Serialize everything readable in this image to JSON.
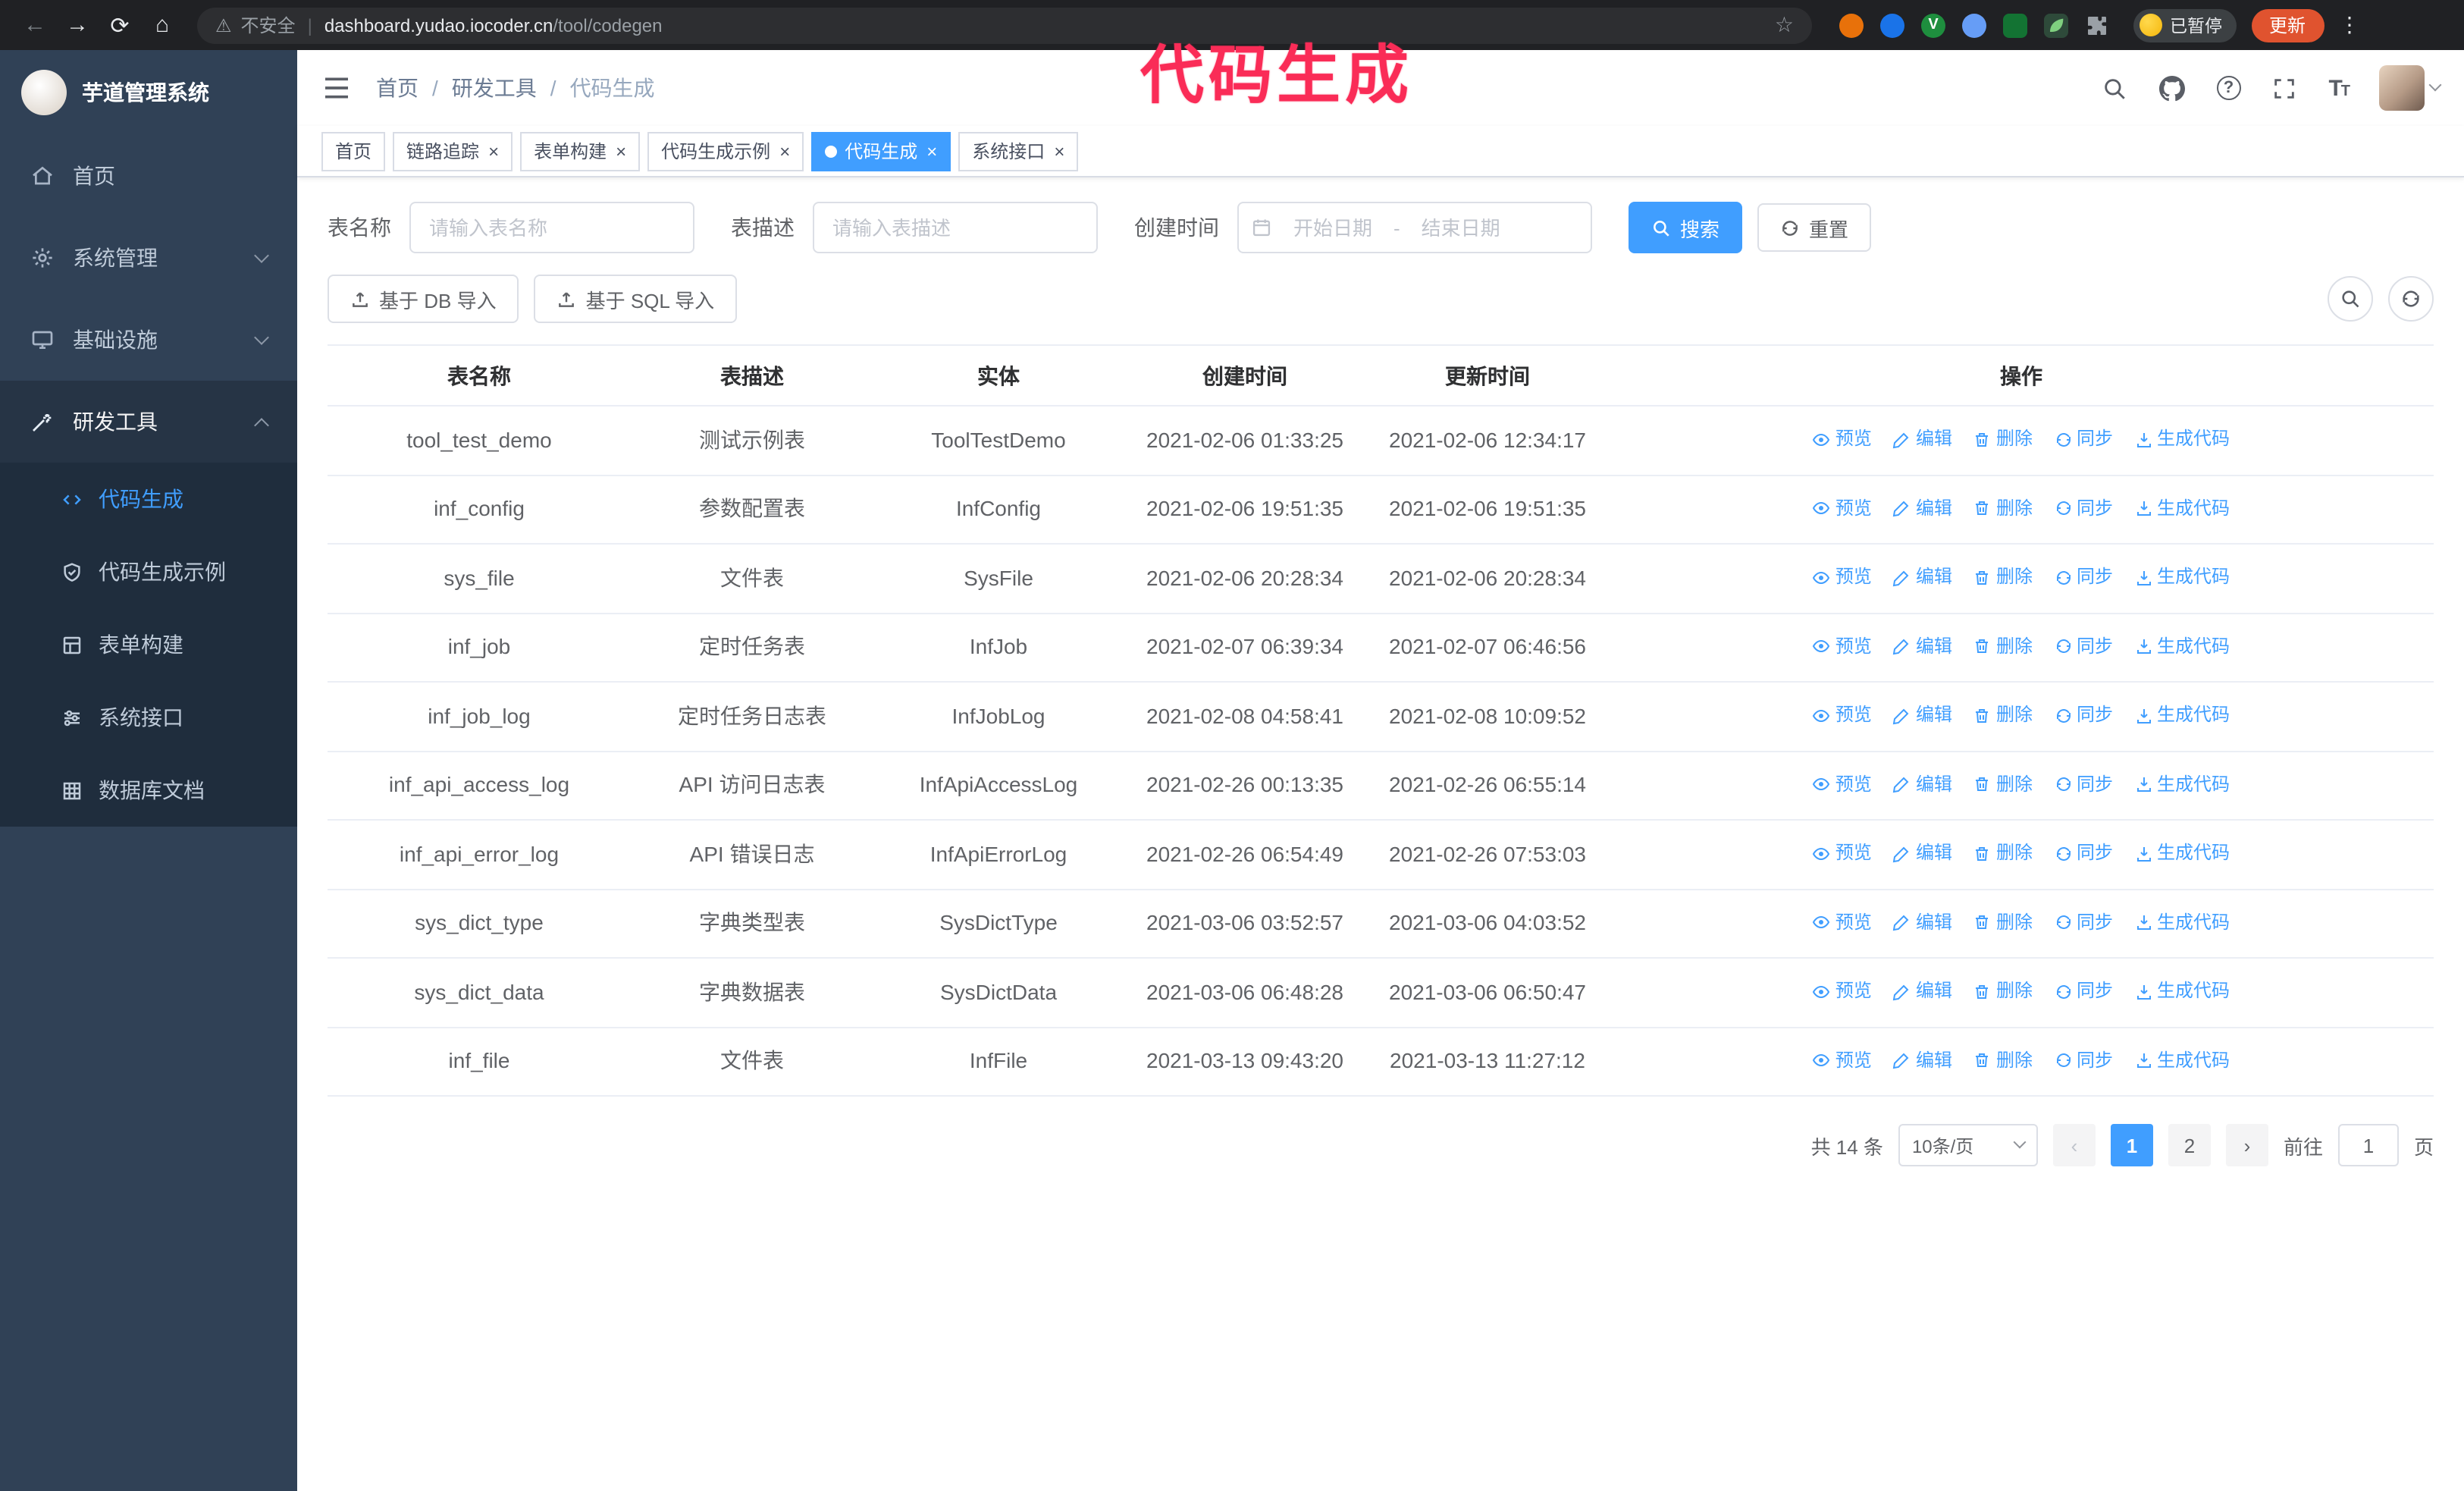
{
  "browser": {
    "security_label": "不安全",
    "url_host": "dashboard.yudao.iocoder.cn",
    "url_path": "/tool/codegen",
    "vue_devtools_letter": "V",
    "paused_badge": "已暂停",
    "update_button": "更新"
  },
  "annotation": {
    "text": "代码生成",
    "color": "#fa2c57"
  },
  "sidebar": {
    "logo_title": "芋道管理系统",
    "items": [
      {
        "label": "首页"
      },
      {
        "label": "系统管理"
      },
      {
        "label": "基础设施"
      },
      {
        "label": "研发工具"
      }
    ],
    "subitems": [
      {
        "label": "代码生成"
      },
      {
        "label": "代码生成示例"
      },
      {
        "label": "表单构建"
      },
      {
        "label": "系统接口"
      },
      {
        "label": "数据库文档"
      }
    ]
  },
  "header": {
    "breadcrumb": [
      "首页",
      "研发工具",
      "代码生成"
    ]
  },
  "tabs": [
    {
      "label": "首页"
    },
    {
      "label": "链路追踪"
    },
    {
      "label": "表单构建"
    },
    {
      "label": "代码生成示例"
    },
    {
      "label": "代码生成"
    },
    {
      "label": "系统接口"
    }
  ],
  "filters": {
    "table_name_label": "表名称",
    "table_name_placeholder": "请输入表名称",
    "table_desc_label": "表描述",
    "table_desc_placeholder": "请输入表描述",
    "create_time_label": "创建时间",
    "start_date_placeholder": "开始日期",
    "range_separator": "-",
    "end_date_placeholder": "结束日期",
    "search_button": "搜索",
    "reset_button": "重置"
  },
  "toolbar": {
    "import_db_button": "基于 DB 导入",
    "import_sql_button": "基于 SQL 导入"
  },
  "table": {
    "columns": [
      "表名称",
      "表描述",
      "实体",
      "创建时间",
      "更新时间",
      "操作"
    ],
    "actions": [
      "预览",
      "编辑",
      "删除",
      "同步",
      "生成代码"
    ],
    "rows": [
      {
        "name": "tool_test_demo",
        "desc": "测试示例表",
        "entity": "ToolTestDemo",
        "created": "2021-02-06 01:33:25",
        "updated": "2021-02-06 12:34:17"
      },
      {
        "name": "inf_config",
        "desc": "参数配置表",
        "entity": "InfConfig",
        "created": "2021-02-06 19:51:35",
        "updated": "2021-02-06 19:51:35"
      },
      {
        "name": "sys_file",
        "desc": "文件表",
        "entity": "SysFile",
        "created": "2021-02-06 20:28:34",
        "updated": "2021-02-06 20:28:34"
      },
      {
        "name": "inf_job",
        "desc": "定时任务表",
        "entity": "InfJob",
        "created": "2021-02-07 06:39:34",
        "updated": "2021-02-07 06:46:56"
      },
      {
        "name": "inf_job_log",
        "desc": "定时任务日志表",
        "entity": "InfJobLog",
        "created": "2021-02-08 04:58:41",
        "updated": "2021-02-08 10:09:52"
      },
      {
        "name": "inf_api_access_log",
        "desc": "API 访问日志表",
        "entity": "InfApiAccessLog",
        "created": "2021-02-26 00:13:35",
        "updated": "2021-02-26 06:55:14"
      },
      {
        "name": "inf_api_error_log",
        "desc": "API 错误日志",
        "entity": "InfApiErrorLog",
        "created": "2021-02-26 06:54:49",
        "updated": "2021-02-26 07:53:03"
      },
      {
        "name": "sys_dict_type",
        "desc": "字典类型表",
        "entity": "SysDictType",
        "created": "2021-03-06 03:52:57",
        "updated": "2021-03-06 04:03:52"
      },
      {
        "name": "sys_dict_data",
        "desc": "字典数据表",
        "entity": "SysDictData",
        "created": "2021-03-06 06:48:28",
        "updated": "2021-03-06 06:50:47"
      },
      {
        "name": "inf_file",
        "desc": "文件表",
        "entity": "InfFile",
        "created": "2021-03-13 09:43:20",
        "updated": "2021-03-13 11:27:12"
      }
    ]
  },
  "pagination": {
    "total_text": "共 14 条",
    "page_size": "10条/页",
    "pages": [
      "1",
      "2"
    ],
    "active_page": "1",
    "goto_label": "前往",
    "goto_value": "1",
    "page_unit": "页"
  },
  "colors": {
    "accent": "#409eff",
    "sidebar_bg": "#304156",
    "submenu_bg": "#1f2d3d",
    "annotation": "#fa2c57",
    "update_button": "#e0532f"
  }
}
